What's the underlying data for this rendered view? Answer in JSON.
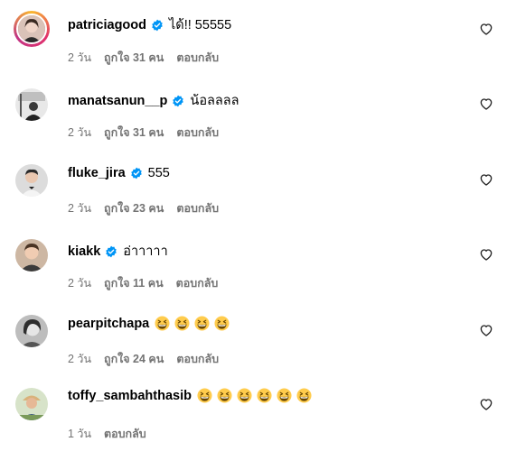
{
  "comments": [
    {
      "username": "patriciagood",
      "verified": true,
      "text": "ได้!! 55555",
      "emoji_count": 0,
      "time": "2 วัน",
      "likes": "ถูกใจ 31 คน",
      "reply": "ตอบกลับ",
      "story_ring": true
    },
    {
      "username": "manatsanun__p",
      "verified": true,
      "text": "น้อลลลล",
      "emoji_count": 0,
      "time": "2 วัน",
      "likes": "ถูกใจ 31 คน",
      "reply": "ตอบกลับ",
      "story_ring": false
    },
    {
      "username": "fluke_jira",
      "verified": true,
      "text": "555",
      "emoji_count": 0,
      "time": "2 วัน",
      "likes": "ถูกใจ 23 คน",
      "reply": "ตอบกลับ",
      "story_ring": false
    },
    {
      "username": "kiakk",
      "verified": true,
      "text": "อ่าาาาา",
      "emoji_count": 0,
      "time": "2 วัน",
      "likes": "ถูกใจ 11 คน",
      "reply": "ตอบกลับ",
      "story_ring": false
    },
    {
      "username": "pearpitchapa",
      "verified": false,
      "text": "",
      "emoji": "😆",
      "emoji_count": 4,
      "time": "2 วัน",
      "likes": "ถูกใจ 24 คน",
      "reply": "ตอบกลับ",
      "story_ring": false
    },
    {
      "username": "toffy_sambahthasib",
      "verified": false,
      "text": "",
      "emoji": "😆",
      "emoji_count": 6,
      "time": "1 วัน",
      "likes": "",
      "reply": "ตอบกลับ",
      "story_ring": false
    }
  ],
  "icons": {
    "verified": "verified-badge-icon",
    "like": "heart-outline-icon",
    "emoji": "grinning-squinting-face-emoji"
  },
  "colors": {
    "verified_blue": "#0095f6",
    "meta_gray": "#737373",
    "emoji_yellow": "#ffcc4d"
  }
}
